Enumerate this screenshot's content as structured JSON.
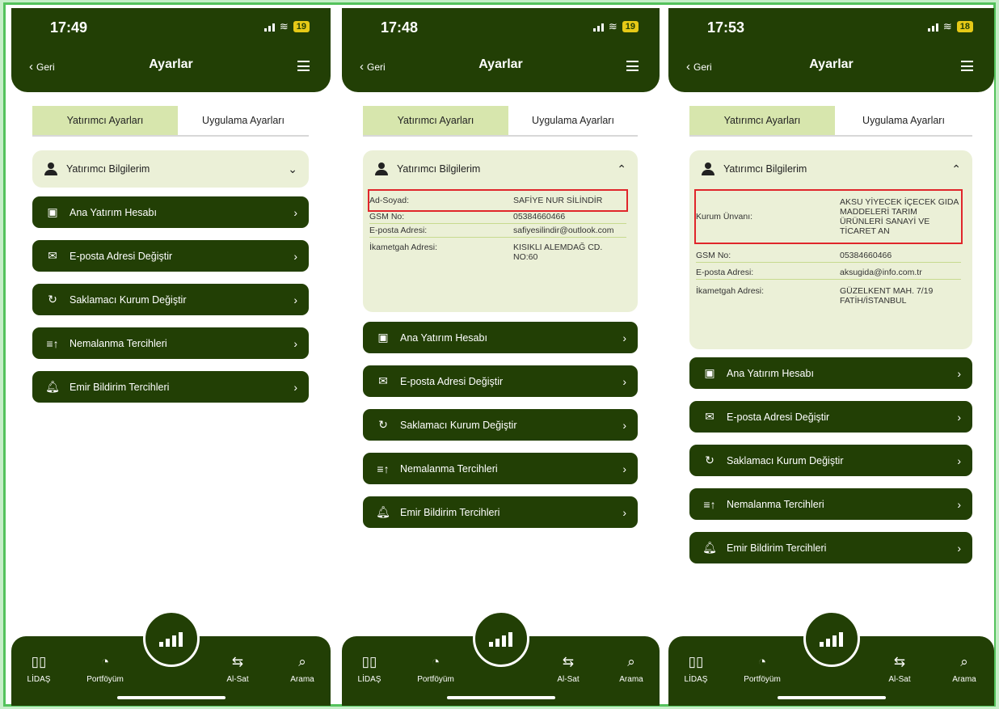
{
  "common": {
    "back_label": "Geri",
    "title": "Ayarlar",
    "tabs": [
      "Yatırımcı Ayarları",
      "Uygulama Ayarları"
    ],
    "accordion_title": "Yatırımcı Bilgilerim",
    "buttons": [
      "Ana Yatırım Hesabı",
      "E-posta Adresi Değiştir",
      "Saklamacı Kurum Değiştir",
      "Nemalanma Tercihleri",
      "Emir Bildirim Tercihleri"
    ],
    "button_icons": [
      "wallet-icon",
      "envelope-icon",
      "refresh-icon",
      "sort-icon",
      "bell-icon"
    ],
    "nav": [
      "LİDAŞ",
      "Portföyüm",
      "Al-Sat",
      "Arama"
    ],
    "nav_icons": [
      "chart-icon",
      "pie-icon",
      "swap-icon",
      "search-icon"
    ],
    "colors": {
      "dark_green": "#223f05",
      "light_green": "#ebf0d7",
      "tab_active": "#d7e6ad",
      "highlight": "#e0262b"
    }
  },
  "screens": [
    {
      "time": "17:49",
      "battery": "19",
      "accordion_open": false
    },
    {
      "time": "17:48",
      "battery": "19",
      "accordion_open": true,
      "info_rows": [
        {
          "label": "Ad-Soyad:",
          "value": "SAFİYE NUR SİLİNDİR",
          "highlighted": true
        },
        {
          "label": "GSM No:",
          "value": "05384660466"
        },
        {
          "label": "E-posta Adresi:",
          "value": "safiyesilindir@outlook.com"
        },
        {
          "label": "İkametgah Adresi:",
          "value": "KISIKLI ALEMDAĞ CD. NO:60"
        }
      ]
    },
    {
      "time": "17:53",
      "battery": "18",
      "accordion_open": true,
      "info_rows": [
        {
          "label": "Kurum Ünvanı:",
          "value": "AKSU YİYECEK İÇECEK GIDA MADDELERİ TARIM ÜRÜNLERİ SANAYİ VE TİCARET AN",
          "highlighted": true
        },
        {
          "label": "GSM No:",
          "value": "05384660466"
        },
        {
          "label": "E-posta Adresi:",
          "value": "aksugida@info.com.tr"
        },
        {
          "label": "İkametgah Adresi:",
          "value": "GÜZELKENT MAH. 7/19 FATİH/İSTANBUL"
        }
      ]
    }
  ]
}
